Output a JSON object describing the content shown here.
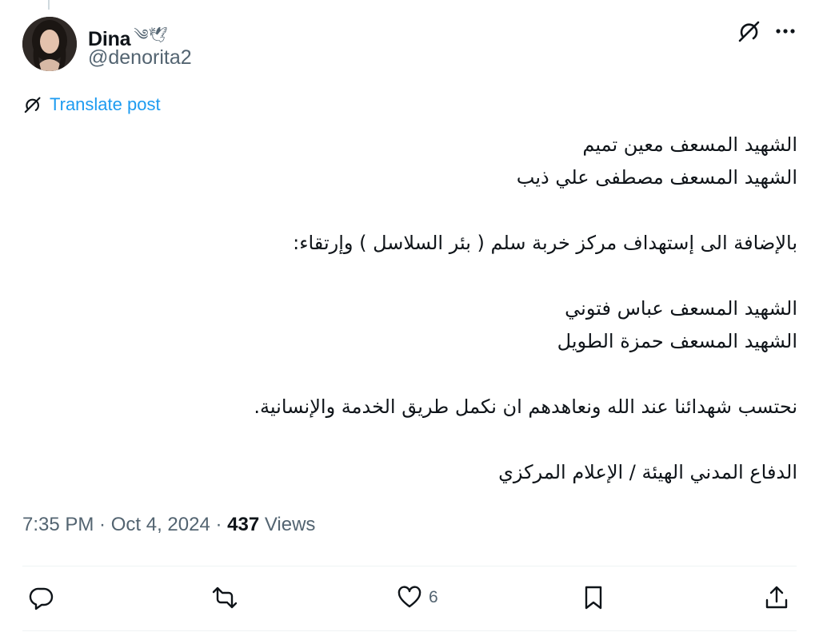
{
  "author": {
    "display_name": "Dina",
    "name_emoji": "༄🕊",
    "handle": "@denorita2"
  },
  "translate": {
    "label": "Translate post"
  },
  "post": {
    "lines": [
      "الشهيد المسعف معين تميم",
      "الشهيد المسعف مصطفى علي ذيب",
      "",
      "بالإضافة الى إستهداف مركز خربة سلم ( بئر السلاسل ) وإرتقاء:",
      "",
      "الشهيد المسعف عباس فتوني",
      "الشهيد المسعف حمزة الطويل",
      "",
      "نحتسب شهدائنا عند الله ونعاهدهم ان نكمل طريق الخدمة والإنسانية.",
      "",
      "الدفاع المدني الهيئة / الإعلام المركزي"
    ]
  },
  "meta": {
    "time": "7:35 PM",
    "separator1": " · ",
    "date": "Oct 4, 2024",
    "separator2": " · ",
    "views_count": "437",
    "views_label": " Views"
  },
  "actions": {
    "reply_count": "",
    "repost_count": "",
    "like_count": "6",
    "bookmark_count": ""
  },
  "icons": {
    "grok": "grok-icon",
    "more": "more-horizontal-icon",
    "reply": "reply-icon",
    "repost": "repost-icon",
    "like": "heart-icon",
    "bookmark": "bookmark-icon",
    "share": "share-icon"
  },
  "colors": {
    "text_primary": "#0f1419",
    "text_secondary": "#536471",
    "link": "#1d9bf0",
    "divider": "#eff3f4"
  }
}
